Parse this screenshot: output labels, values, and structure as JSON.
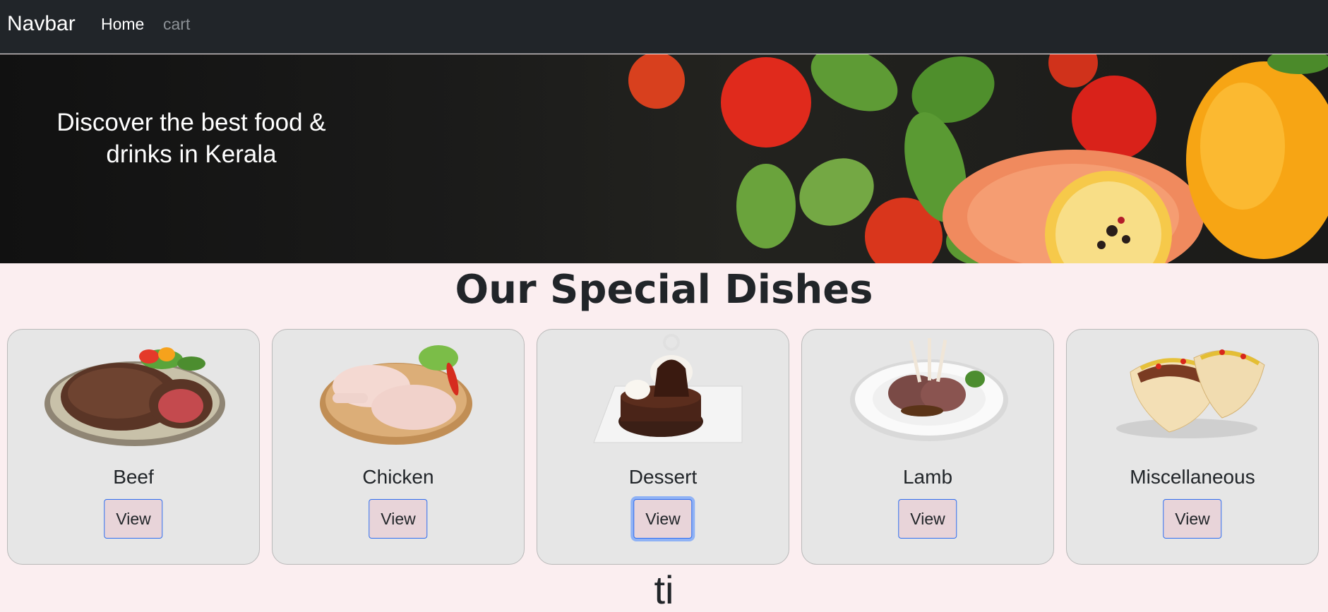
{
  "navbar": {
    "brand": "Navbar",
    "links": [
      {
        "label": "Home",
        "active": true
      },
      {
        "label": "cart",
        "active": false
      }
    ]
  },
  "hero": {
    "line1": "Discover the best food &",
    "line2": "drinks in Kerala"
  },
  "section": {
    "title": "Our Special Dishes"
  },
  "cards": [
    {
      "name": "Beef",
      "button": "View",
      "image": "beef-steak-image"
    },
    {
      "name": "Chicken",
      "button": "View",
      "image": "chicken-legs-image"
    },
    {
      "name": "Dessert",
      "button": "View",
      "image": "chocolate-dessert-image",
      "focused": true
    },
    {
      "name": "Lamb",
      "button": "View",
      "image": "lamb-chops-image"
    },
    {
      "name": "Miscellaneous",
      "button": "View",
      "image": "tacos-image"
    }
  ],
  "bottom_partial_text": "ti"
}
